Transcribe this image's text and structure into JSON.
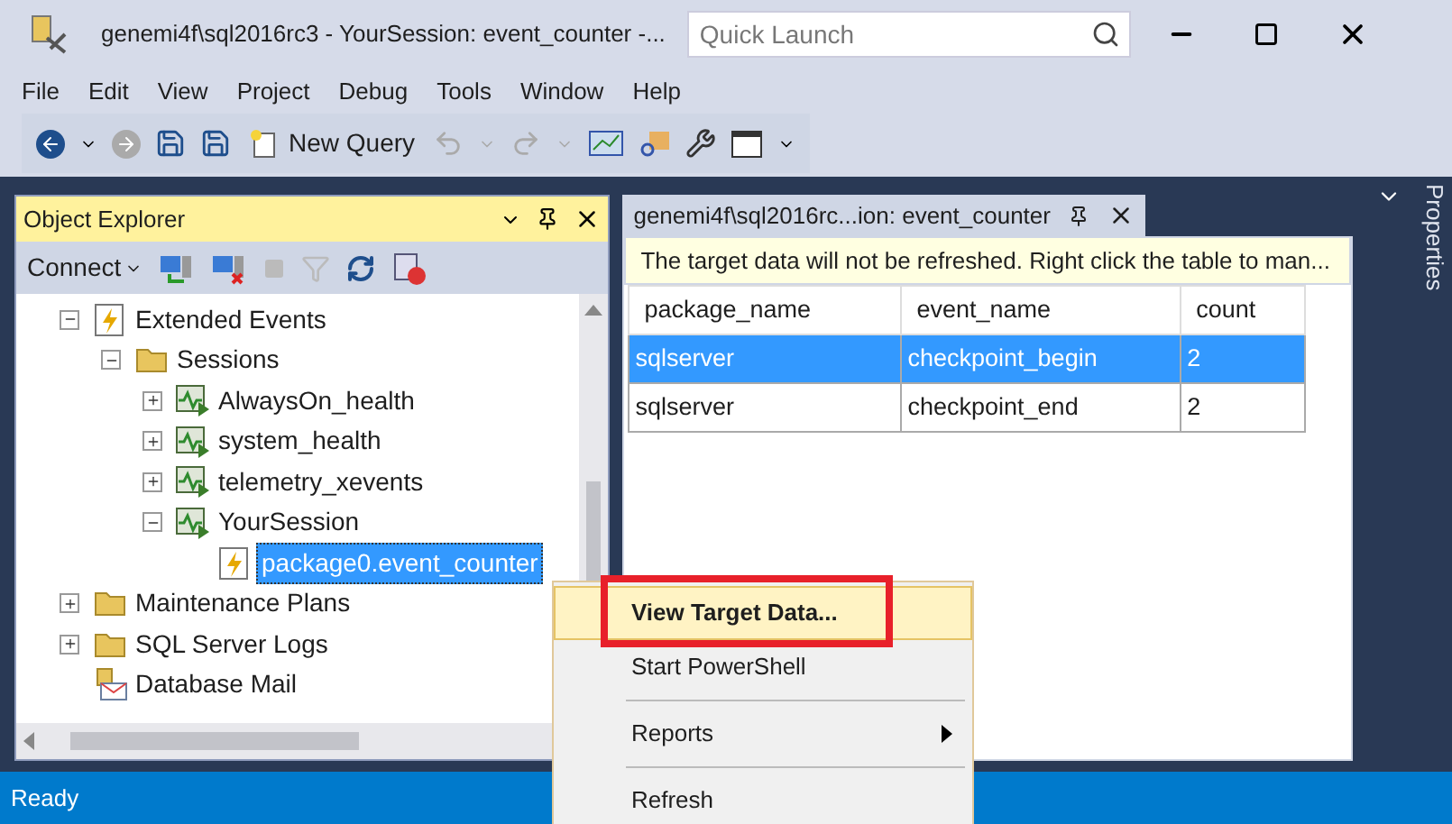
{
  "window": {
    "title": "genemi4f\\sql2016rc3 - YourSession: event_counter -...",
    "quick_launch": {
      "placeholder": "Quick Launch"
    }
  },
  "menu": [
    "File",
    "Edit",
    "View",
    "Project",
    "Debug",
    "Tools",
    "Window",
    "Help"
  ],
  "toolbar": {
    "new_query": "New Query"
  },
  "object_explorer": {
    "title": "Object Explorer",
    "connect": "Connect",
    "tree": [
      {
        "label": "Extended Events",
        "kind": "events",
        "expanded": true,
        "selected": false,
        "children": [
          {
            "label": "Sessions",
            "kind": "folder",
            "expanded": true,
            "selected": false,
            "children": [
              {
                "label": "AlwaysOn_health",
                "kind": "session",
                "expanded": false,
                "selected": false
              },
              {
                "label": "system_health",
                "kind": "session",
                "expanded": false,
                "selected": false
              },
              {
                "label": "telemetry_xevents",
                "kind": "session",
                "expanded": false,
                "selected": false
              },
              {
                "label": "YourSession",
                "kind": "session",
                "expanded": true,
                "selected": false,
                "children": [
                  {
                    "label": "package0.event_counter",
                    "kind": "target",
                    "selected": true
                  }
                ]
              }
            ]
          }
        ]
      },
      {
        "label": "Maintenance Plans",
        "kind": "folder",
        "expanded": false,
        "selected": false
      },
      {
        "label": "SQL Server Logs",
        "kind": "folder",
        "expanded": false,
        "selected": false
      },
      {
        "label": "Database Mail",
        "kind": "mail",
        "selected": false
      }
    ]
  },
  "document": {
    "tab": "genemi4f\\sql2016rc...ion: event_counter",
    "info": "The target data will not be refreshed. Right click the table to man...",
    "table": {
      "columns": [
        "package_name",
        "event_name",
        "count"
      ],
      "rows": [
        {
          "cells": [
            "sqlserver",
            "checkpoint_begin",
            "2"
          ],
          "selected": true
        },
        {
          "cells": [
            "sqlserver",
            "checkpoint_end",
            "2"
          ],
          "selected": false
        }
      ]
    }
  },
  "properties_tab": "Properties",
  "context_menu": [
    {
      "label": "View Target Data...",
      "selected": true,
      "highlighted": true,
      "submenu": false,
      "separator_before": false
    },
    {
      "label": "Start PowerShell",
      "selected": false,
      "highlighted": false,
      "submenu": false,
      "separator_before": false
    },
    {
      "label": "Reports",
      "selected": false,
      "highlighted": false,
      "submenu": true,
      "separator_before": true
    },
    {
      "label": "Refresh",
      "selected": false,
      "highlighted": false,
      "submenu": false,
      "separator_before": true
    }
  ],
  "status_bar": "Ready"
}
